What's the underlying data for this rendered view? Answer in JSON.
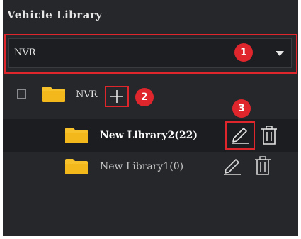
{
  "panel": {
    "title": "Vehicle Library"
  },
  "dropdown": {
    "selected": "NVR"
  },
  "tree": {
    "root": {
      "label": "NVR"
    },
    "libraries": [
      {
        "label": "New Library2(22)",
        "selected": true
      },
      {
        "label": "New Library1(0)",
        "selected": false
      }
    ]
  },
  "callouts": [
    "1",
    "2",
    "3"
  ],
  "colors": {
    "panel_bg": "#26272b",
    "selected_row": "#1c1d20",
    "folder": "#f6c12a",
    "highlight": "#e0262d",
    "text_primary": "#ffffff",
    "text_secondary": "#c8c8c8"
  },
  "icons": {
    "collapse": "collapse-minus-icon",
    "folder": "folder-icon",
    "add": "plus-icon",
    "edit": "pencil-icon",
    "delete": "trash-icon",
    "dropdown": "caret-down-icon"
  }
}
